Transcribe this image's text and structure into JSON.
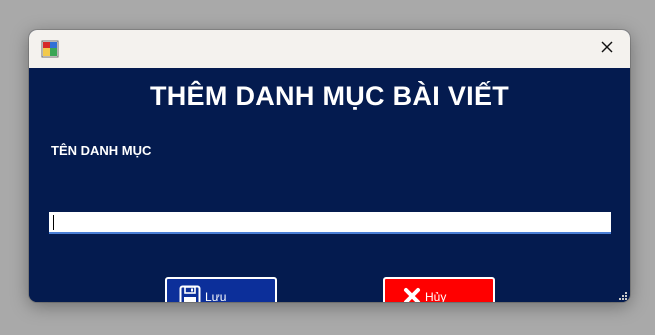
{
  "window": {
    "heading": "THÊM DANH MỤC BÀI VIẾT",
    "close_icon": "close-icon",
    "app_icon": "form-icon"
  },
  "form": {
    "category_label": "TÊN DANH MỤC",
    "category_value": "",
    "save_label": "Lưu",
    "save_icon": "floppy-disk-icon",
    "cancel_label": "Hủy",
    "cancel_icon": "x-mark-icon"
  },
  "colors": {
    "titlebar": "#f4f2ee",
    "client_background": "#041b4f",
    "save_button": "#0c2f9a",
    "cancel_button": "#ff0000"
  }
}
